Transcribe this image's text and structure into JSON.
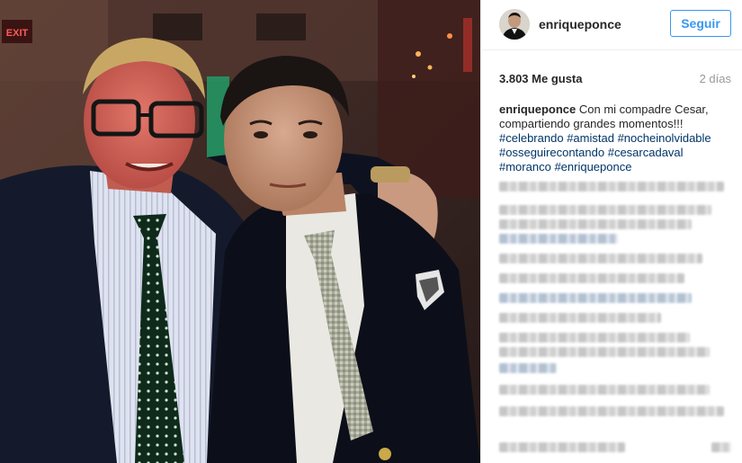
{
  "post": {
    "username": "enriqueponce",
    "follow_label": "Seguir",
    "likes": "3.803 Me gusta",
    "time_ago": "2 días",
    "caption_author": "enriqueponce",
    "caption_text": "Con mi compadre Cesar, compartiendo grandes momentos!!!",
    "hashtags": [
      "#celebrando",
      "#amistad",
      "#nocheinolvidable",
      "#osseguirecontando",
      "#cesarcadaval",
      "#moranco",
      "#enriqueponce"
    ]
  },
  "photo": {
    "exit_sign": "EXIT"
  },
  "colors": {
    "accent": "#3897f0",
    "hashtag": "#003569",
    "muted": "#999999"
  }
}
